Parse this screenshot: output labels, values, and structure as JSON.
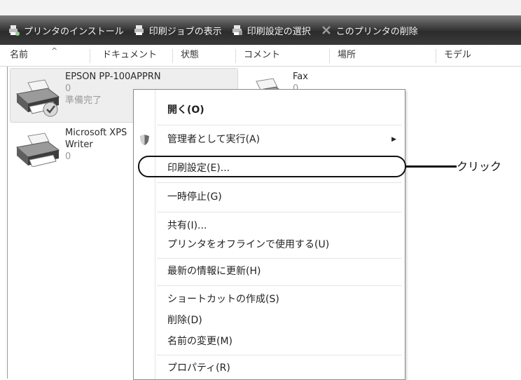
{
  "toolbar": {
    "items": [
      {
        "label": "プリンタのインストール",
        "icon": "printer-install-icon"
      },
      {
        "label": "印刷ジョブの表示",
        "icon": "print-jobs-icon"
      },
      {
        "label": "印刷設定の選択",
        "icon": "print-settings-icon"
      },
      {
        "label": "このプリンタの削除",
        "icon": "delete-printer-icon"
      }
    ]
  },
  "columns": [
    "名前",
    "ドキュメント",
    "状態",
    "コメント",
    "場所",
    "モデル"
  ],
  "printers": [
    {
      "name": "EPSON PP-100APPRN",
      "docs": "0",
      "status": "準備完了"
    },
    {
      "name": "Fax",
      "docs": "0"
    },
    {
      "name_line1": "Microsoft XPS",
      "name_line2": "Writer",
      "docs": "0"
    }
  ],
  "context_menu": {
    "open": "開く(O)",
    "run_as_admin": "管理者として実行(A)",
    "print_settings": "印刷設定(E)...",
    "pause": "一時停止(G)",
    "share": "共有(I)...",
    "use_offline": "プリンタをオフラインで使用する(U)",
    "refresh": "最新の情報に更新(H)",
    "create_shortcut": "ショートカットの作成(S)",
    "delete": "削除(D)",
    "rename": "名前の変更(M)",
    "properties": "プロパティ(R)"
  },
  "annotation": {
    "label": "クリック"
  }
}
